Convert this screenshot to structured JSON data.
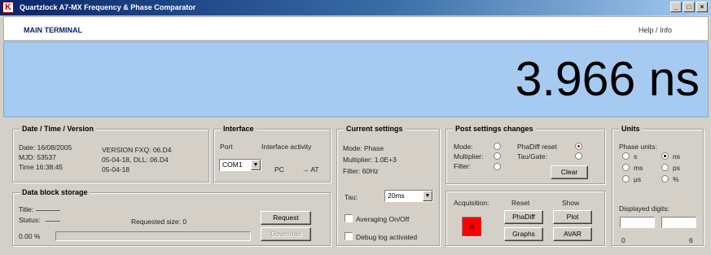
{
  "window": {
    "title": "Quartzlock A7-MX Frequency & Phase Comparator",
    "app_icon_glyph": "K",
    "buttons": {
      "minimize": "_",
      "maximize": "□",
      "close": "×"
    }
  },
  "menubar": {
    "left": "MAIN TERMINAL",
    "right": "Help / Info"
  },
  "display": {
    "value": "3.966 ns",
    "background": "#a6caf0"
  },
  "date_time": {
    "title": "Date / Time / Version",
    "date": "Date: 16/08/2005",
    "mjd": "MJD: 53537",
    "time": "Time 16:38:45",
    "version_fxq": "VERSION FXQ: 06.D4",
    "version_line2": "05-04-18, DLL: 06.D4",
    "version_line3": "05-04-18"
  },
  "interface": {
    "title": "Interface",
    "port_label": "Port",
    "activity_label": "Interface activity",
    "port_value": "COM1",
    "pc_label": "PC",
    "at_label": "→ AT"
  },
  "storage": {
    "title": "Data block storage",
    "title_label": "Title:",
    "status_label": "Status:",
    "requested_size": "Requested size: 0",
    "percent": "0.00 %",
    "progress_fraction": 0,
    "request_button": "Request",
    "download_button": "Download"
  },
  "current_settings": {
    "title": "Current settings",
    "mode": "Mode:   Phase",
    "multiplier": "Multiplier: 1.0E+3",
    "filter": "Filter:    60Hz",
    "tau_label": "Tau:",
    "tau_value": "20ms",
    "averaging": "Averaging On/Off",
    "averaging_checked": false,
    "debug": "Debug log activated",
    "debug_checked": false
  },
  "post_settings": {
    "title": "Post settings changes",
    "mode": "Mode:",
    "multiplier": "Multiplier:",
    "filter": "Filter:",
    "phadiff_reset": "PhaDiff reset",
    "tau_gate": "Tau/Gate:",
    "clear_button": "Clear",
    "accent": "#e00000"
  },
  "acquisition": {
    "acquisition_label": "Acquisition:",
    "reset_label": "Reset",
    "show_label": "Show",
    "phadiff_button": "PhaDiff",
    "plot_button": "Plot",
    "graphs_button": "Graphs",
    "adev_button": "AVAR",
    "led_color": "#ff0000"
  },
  "units": {
    "title": "Units",
    "phase_units_label": "Phase units:",
    "options": [
      "s",
      "ns",
      "ms",
      "ps",
      "µs",
      "%"
    ],
    "selected": "ns",
    "digits_label": "Displayed digits:",
    "scale_min": "0",
    "scale_max": "6"
  }
}
